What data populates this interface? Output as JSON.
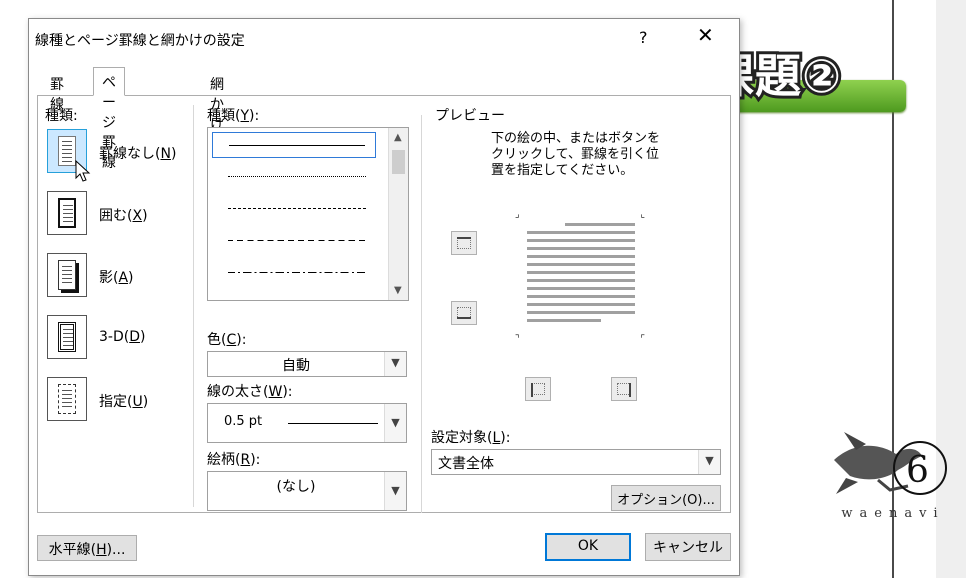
{
  "dialog": {
    "title": "線種とページ罫線と網かけの設定",
    "help": "?",
    "close": "✕"
  },
  "tabs": [
    {
      "label": "罫線",
      "active": false
    },
    {
      "label": "ページ罫線",
      "active": true
    },
    {
      "label": "網かけ",
      "active": false
    }
  ],
  "settings": {
    "heading_prefix": "種類",
    "heading_suffix": ":",
    "items": [
      {
        "label": "罫線なし(",
        "key": "N",
        "tail": ")",
        "selected": true
      },
      {
        "label": "囲む(",
        "key": "X",
        "tail": ")",
        "selected": false
      },
      {
        "label": "影(",
        "key": "A",
        "tail": ")",
        "selected": false
      },
      {
        "label": "3-D(",
        "key": "D",
        "tail": ")",
        "selected": false
      },
      {
        "label": "指定(",
        "key": "U",
        "tail": ")",
        "selected": false
      }
    ]
  },
  "style": {
    "heading_prefix": "種類(",
    "heading_key": "Y",
    "heading_suffix": "):"
  },
  "color": {
    "label_prefix": "色(",
    "label_key": "C",
    "label_suffix": "):",
    "value": "自動"
  },
  "width": {
    "label_prefix": "線の太さ(",
    "label_key": "W",
    "label_suffix": "):",
    "value": "0.5 pt"
  },
  "art": {
    "label_prefix": "絵柄(",
    "label_key": "R",
    "label_suffix": "):",
    "value": "(なし)"
  },
  "preview": {
    "heading": "プレビュー",
    "instructions": [
      "下の絵の中、またはボタンを",
      "クリックして、罫線を引く位",
      "置を指定してください。"
    ]
  },
  "apply_to": {
    "label_prefix": "設定対象(",
    "label_key": "L",
    "label_suffix": "):",
    "value": "文書全体"
  },
  "buttons": {
    "options": "オプション(O)...",
    "horizontal_line_prefix": "水平線(",
    "horizontal_line_key": "H",
    "horizontal_line_suffix": ")...",
    "ok": "OK",
    "cancel": "キャンセル"
  },
  "overlay": {
    "badge_text": "課題②",
    "brand": "waenavi",
    "banner_color": "#6cb83a"
  }
}
